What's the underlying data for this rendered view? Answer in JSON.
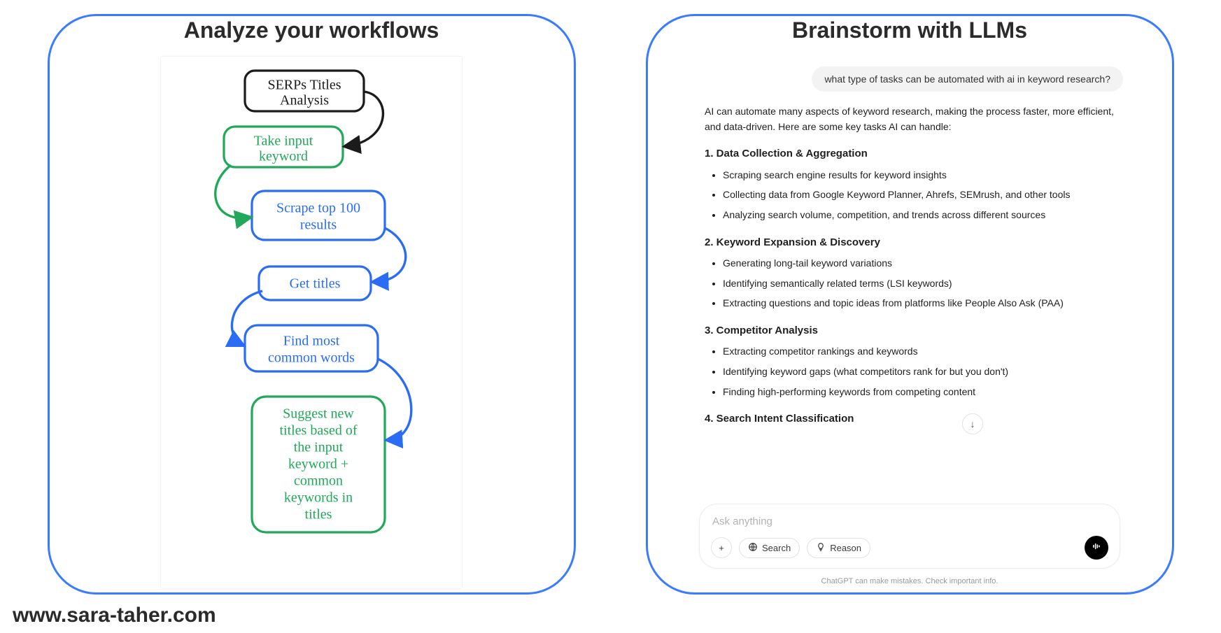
{
  "left": {
    "title": "Analyze your workflows",
    "nodes": [
      {
        "id": "n0",
        "lines": [
          "SERPs Titles",
          "Analysis"
        ],
        "color": "#1b1b1b"
      },
      {
        "id": "n1",
        "lines": [
          "Take input",
          "keyword"
        ],
        "color": "#22a85a"
      },
      {
        "id": "n2",
        "lines": [
          "Scrape top 100",
          "results"
        ],
        "color": "#2a6df4"
      },
      {
        "id": "n3",
        "lines": [
          "Get titles"
        ],
        "color": "#2a6df4"
      },
      {
        "id": "n4",
        "lines": [
          "Find most",
          "common words"
        ],
        "color": "#2a6df4"
      },
      {
        "id": "n5",
        "lines": [
          "Suggest new",
          "titles based of",
          "the input",
          "keyword +",
          "common",
          "keywords in",
          "titles"
        ],
        "color": "#22a85a"
      }
    ]
  },
  "right": {
    "title": "Brainstorm with LLMs",
    "user_message": "what type of tasks can be automated with ai in keyword research?",
    "assistant_intro": "AI can automate many aspects of keyword research, making the process faster, more efficient, and data-driven. Here are some key tasks AI can handle:",
    "sections": [
      {
        "heading": "1. Data Collection & Aggregation",
        "items": [
          "Scraping search engine results for keyword insights",
          "Collecting data from Google Keyword Planner, Ahrefs, SEMrush, and other tools",
          "Analyzing search volume, competition, and trends across different sources"
        ]
      },
      {
        "heading": "2. Keyword Expansion & Discovery",
        "items": [
          "Generating long-tail keyword variations",
          "Identifying semantically related terms (LSI keywords)",
          "Extracting questions and topic ideas from platforms like People Also Ask (PAA)"
        ]
      },
      {
        "heading": "3. Competitor Analysis",
        "items": [
          "Extracting competitor rankings and keywords",
          "Identifying keyword gaps (what competitors rank for but you don't)",
          "Finding high-performing keywords from competing content"
        ]
      },
      {
        "heading": "4. Search Intent Classification",
        "items": []
      }
    ],
    "composer": {
      "placeholder": "Ask anything",
      "search_label": "Search",
      "reason_label": "Reason"
    },
    "disclaimer": "ChatGPT can make mistakes. Check important info."
  },
  "footer_url": "www.sara-taher.com"
}
